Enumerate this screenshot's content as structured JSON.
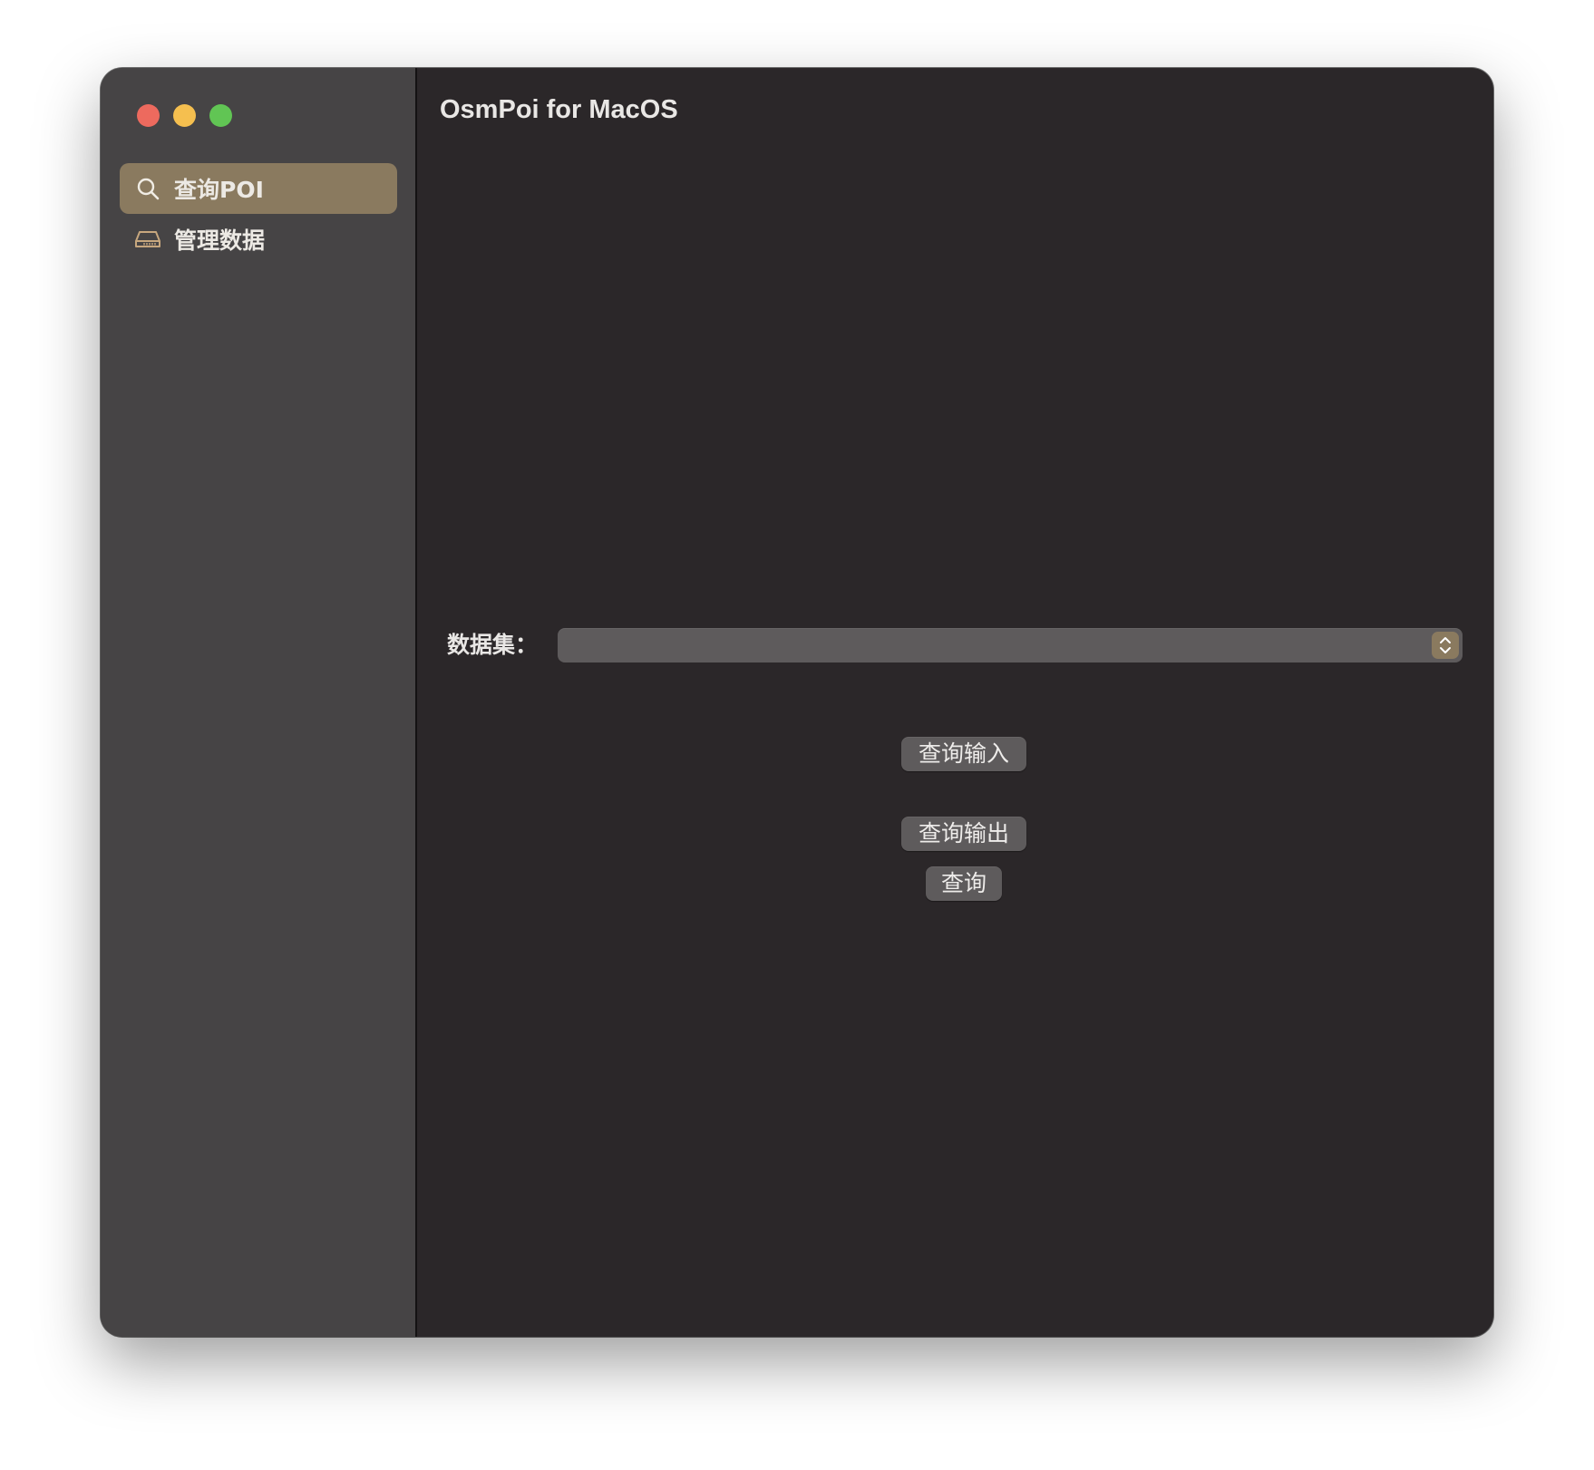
{
  "window": {
    "app_title": "OsmPoi for MacOS"
  },
  "sidebar": {
    "items": [
      {
        "label": "查询POI",
        "icon": "search-icon",
        "selected": true
      },
      {
        "label": "管理数据",
        "icon": "drive-icon",
        "selected": false
      }
    ]
  },
  "main": {
    "dataset_label": "数据集：",
    "dataset_value": "",
    "buttons": {
      "query_input": "查询输入",
      "query_output": "查询输出",
      "query": "查询"
    }
  },
  "colors": {
    "sidebar_bg": "#464445",
    "main_bg": "#2b2729",
    "accent": "#8a7a5f",
    "control_bg": "#5e5b5c",
    "close": "#ed6a5e",
    "minimize": "#f5bf4f",
    "zoom": "#61c554"
  }
}
